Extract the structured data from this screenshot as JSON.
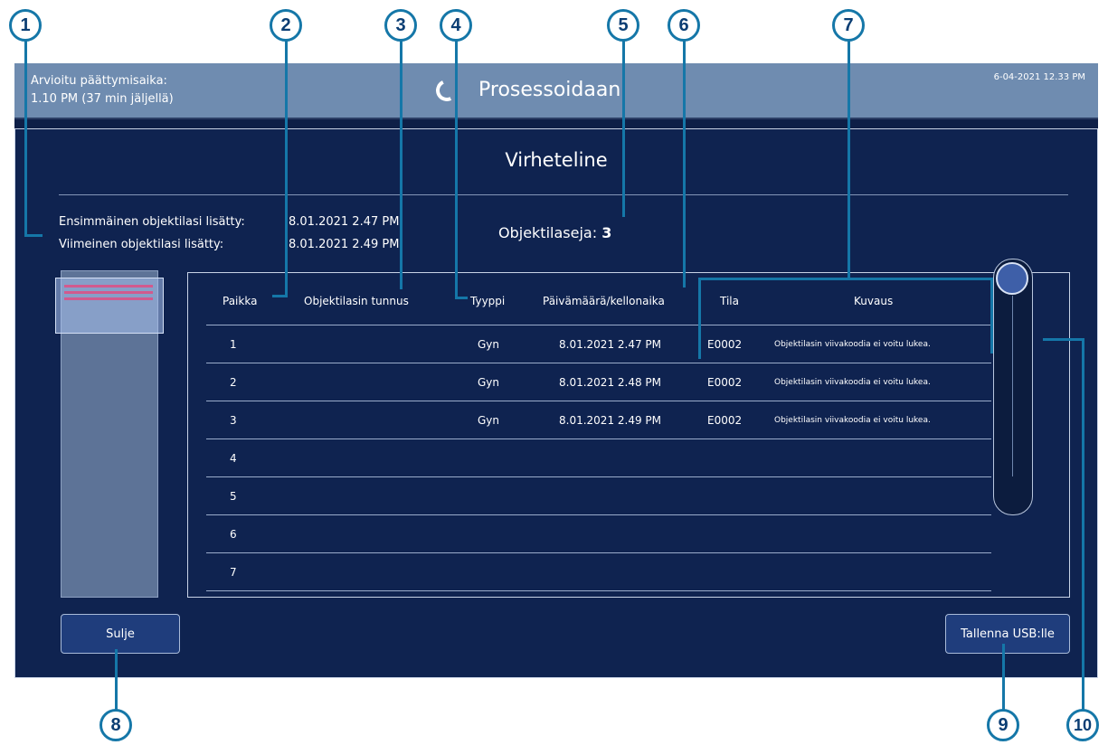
{
  "topbar": {
    "eta_label": "Arvioitu päättymisaika:",
    "eta_value": "1.10 PM (37 min jäljellä)",
    "status": "Prosessoidaan",
    "datetime": "6-04-2021 12.33 PM"
  },
  "dialog": {
    "title": "Virheteline",
    "first_added_label": "Ensimmäinen objektilasi lisätty:",
    "first_added_value": "8.01.2021 2.47 PM",
    "last_added_label": "Viimeinen objektilasi lisätty:",
    "last_added_value": "8.01.2021 2.49 PM",
    "count_label": "Objektilaseja:",
    "count_value": "3"
  },
  "table": {
    "headers": {
      "position": "Paikka",
      "slide_id": "Objektilasin tunnus",
      "type": "Tyyppi",
      "datetime": "Päivämäärä/kellonaika",
      "status": "Tila",
      "description": "Kuvaus"
    },
    "rows": [
      {
        "position": "1",
        "slide_id": "",
        "type": "Gyn",
        "datetime": "8.01.2021 2.47 PM",
        "status": "E0002",
        "description": "Objektilasin viivakoodia ei voitu lukea."
      },
      {
        "position": "2",
        "slide_id": "",
        "type": "Gyn",
        "datetime": "8.01.2021 2.48 PM",
        "status": "E0002",
        "description": "Objektilasin viivakoodia ei voitu lukea."
      },
      {
        "position": "3",
        "slide_id": "",
        "type": "Gyn",
        "datetime": "8.01.2021 2.49 PM",
        "status": "E0002",
        "description": "Objektilasin viivakoodia ei voitu lukea."
      },
      {
        "position": "4",
        "slide_id": "",
        "type": "",
        "datetime": "",
        "status": "",
        "description": ""
      },
      {
        "position": "5",
        "slide_id": "",
        "type": "",
        "datetime": "",
        "status": "",
        "description": ""
      },
      {
        "position": "6",
        "slide_id": "",
        "type": "",
        "datetime": "",
        "status": "",
        "description": ""
      },
      {
        "position": "7",
        "slide_id": "",
        "type": "",
        "datetime": "",
        "status": "",
        "description": ""
      }
    ]
  },
  "buttons": {
    "close": "Sulje",
    "save_usb": "Tallenna USB:lle"
  },
  "callouts": [
    "1",
    "2",
    "3",
    "4",
    "5",
    "6",
    "7",
    "8",
    "9",
    "10"
  ],
  "colors": {
    "callout": "#1577a8",
    "marker": "#d25a8e",
    "background": "#0e1f47"
  }
}
